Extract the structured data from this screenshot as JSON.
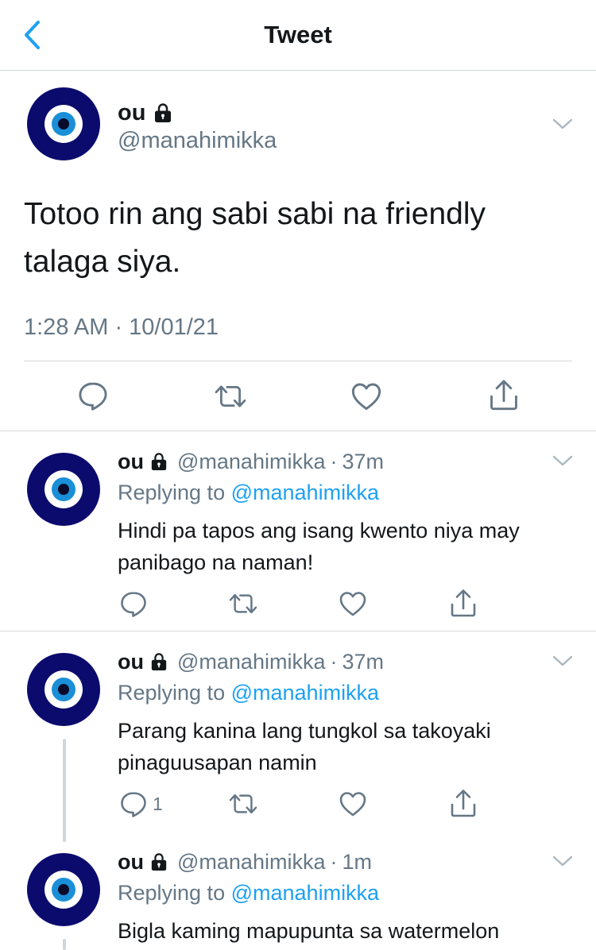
{
  "nav": {
    "title": "Tweet",
    "back_icon": "chevron-left-icon"
  },
  "colors": {
    "accent": "#1da1f2",
    "secondary_text": "#657786",
    "divider": "#d4d8db",
    "avatar_navy": "#0b0b6e",
    "avatar_blue": "#1a8fd8"
  },
  "main_tweet": {
    "name": "ou",
    "handle": "@manahimikka",
    "text": "Totoo rin ang sabi sabi na friendly talaga siya.",
    "timestamp": "1:28 AM · 10/01/21"
  },
  "replies": [
    {
      "name": "ou",
      "handle": "@manahimikka",
      "dot": "·",
      "time": "37m",
      "replying_label": "Replying to",
      "replying_to": "@manahimikka",
      "text": "Hindi pa tapos ang isang kwento niya may panibago na naman!",
      "reply_count": ""
    },
    {
      "name": "ou",
      "handle": "@manahimikka",
      "dot": "·",
      "time": "37m",
      "replying_label": "Replying to",
      "replying_to": "@manahimikka",
      "text": "Parang kanina lang tungkol sa takoyaki pinaguusapan namin",
      "reply_count": "1"
    },
    {
      "name": "ou",
      "handle": "@manahimikka",
      "dot": "·",
      "time": "1m",
      "replying_label": "Replying to",
      "replying_to": "@manahimikka",
      "text": "Bigla kaming mapupunta sa watermelon",
      "reply_count": ""
    }
  ]
}
